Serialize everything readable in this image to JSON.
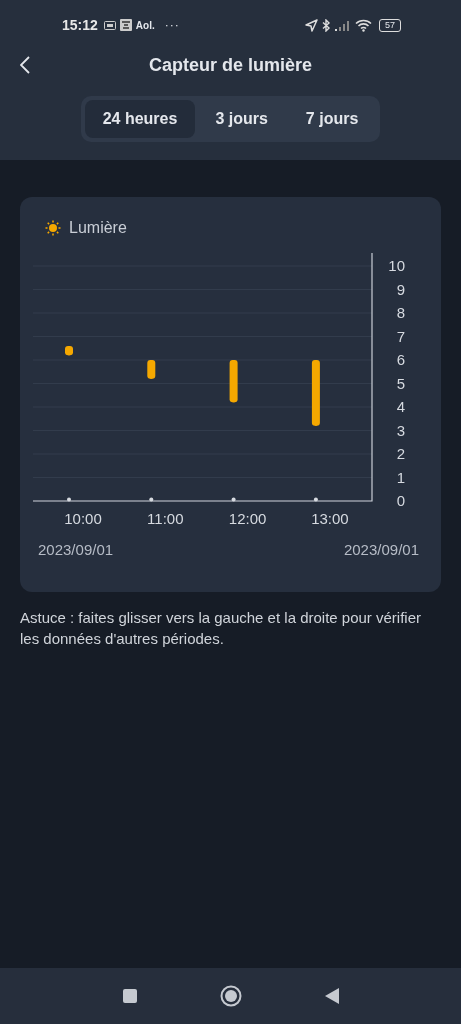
{
  "status_bar": {
    "time": "15:12",
    "app_label": "Aol.",
    "more": "···",
    "battery": "57"
  },
  "header": {
    "title": "Capteur de lumière"
  },
  "tabs": [
    {
      "label": "24 heures",
      "selected": true
    },
    {
      "label": "3 jours",
      "selected": false
    },
    {
      "label": "7 jours",
      "selected": false
    }
  ],
  "card": {
    "chart_data": {
      "type": "candlestick",
      "categories": [
        "10:00",
        "11:00",
        "12:00",
        "13:00"
      ],
      "series": [
        {
          "name": "Lumière",
          "color": "#f5a800",
          "ohlc": [
            [
              6.2,
              6.6,
              6.2,
              6.6
            ],
            [
              5.2,
              6.0,
              5.2,
              6.0
            ],
            [
              4.2,
              6.0,
              4.2,
              6.0
            ],
            [
              3.2,
              6.0,
              3.2,
              6.0
            ]
          ]
        }
      ],
      "ylim": [
        0,
        10
      ],
      "grid": true,
      "yticks": [
        0,
        1,
        2,
        3,
        4,
        5,
        6,
        7,
        8,
        9,
        10
      ]
    },
    "date_start": "2023/09/01",
    "date_end": "2023/09/01"
  },
  "tip": "Astuce : faites glisser vers la gauche et la droite pour vérifier les données d'autres périodes."
}
